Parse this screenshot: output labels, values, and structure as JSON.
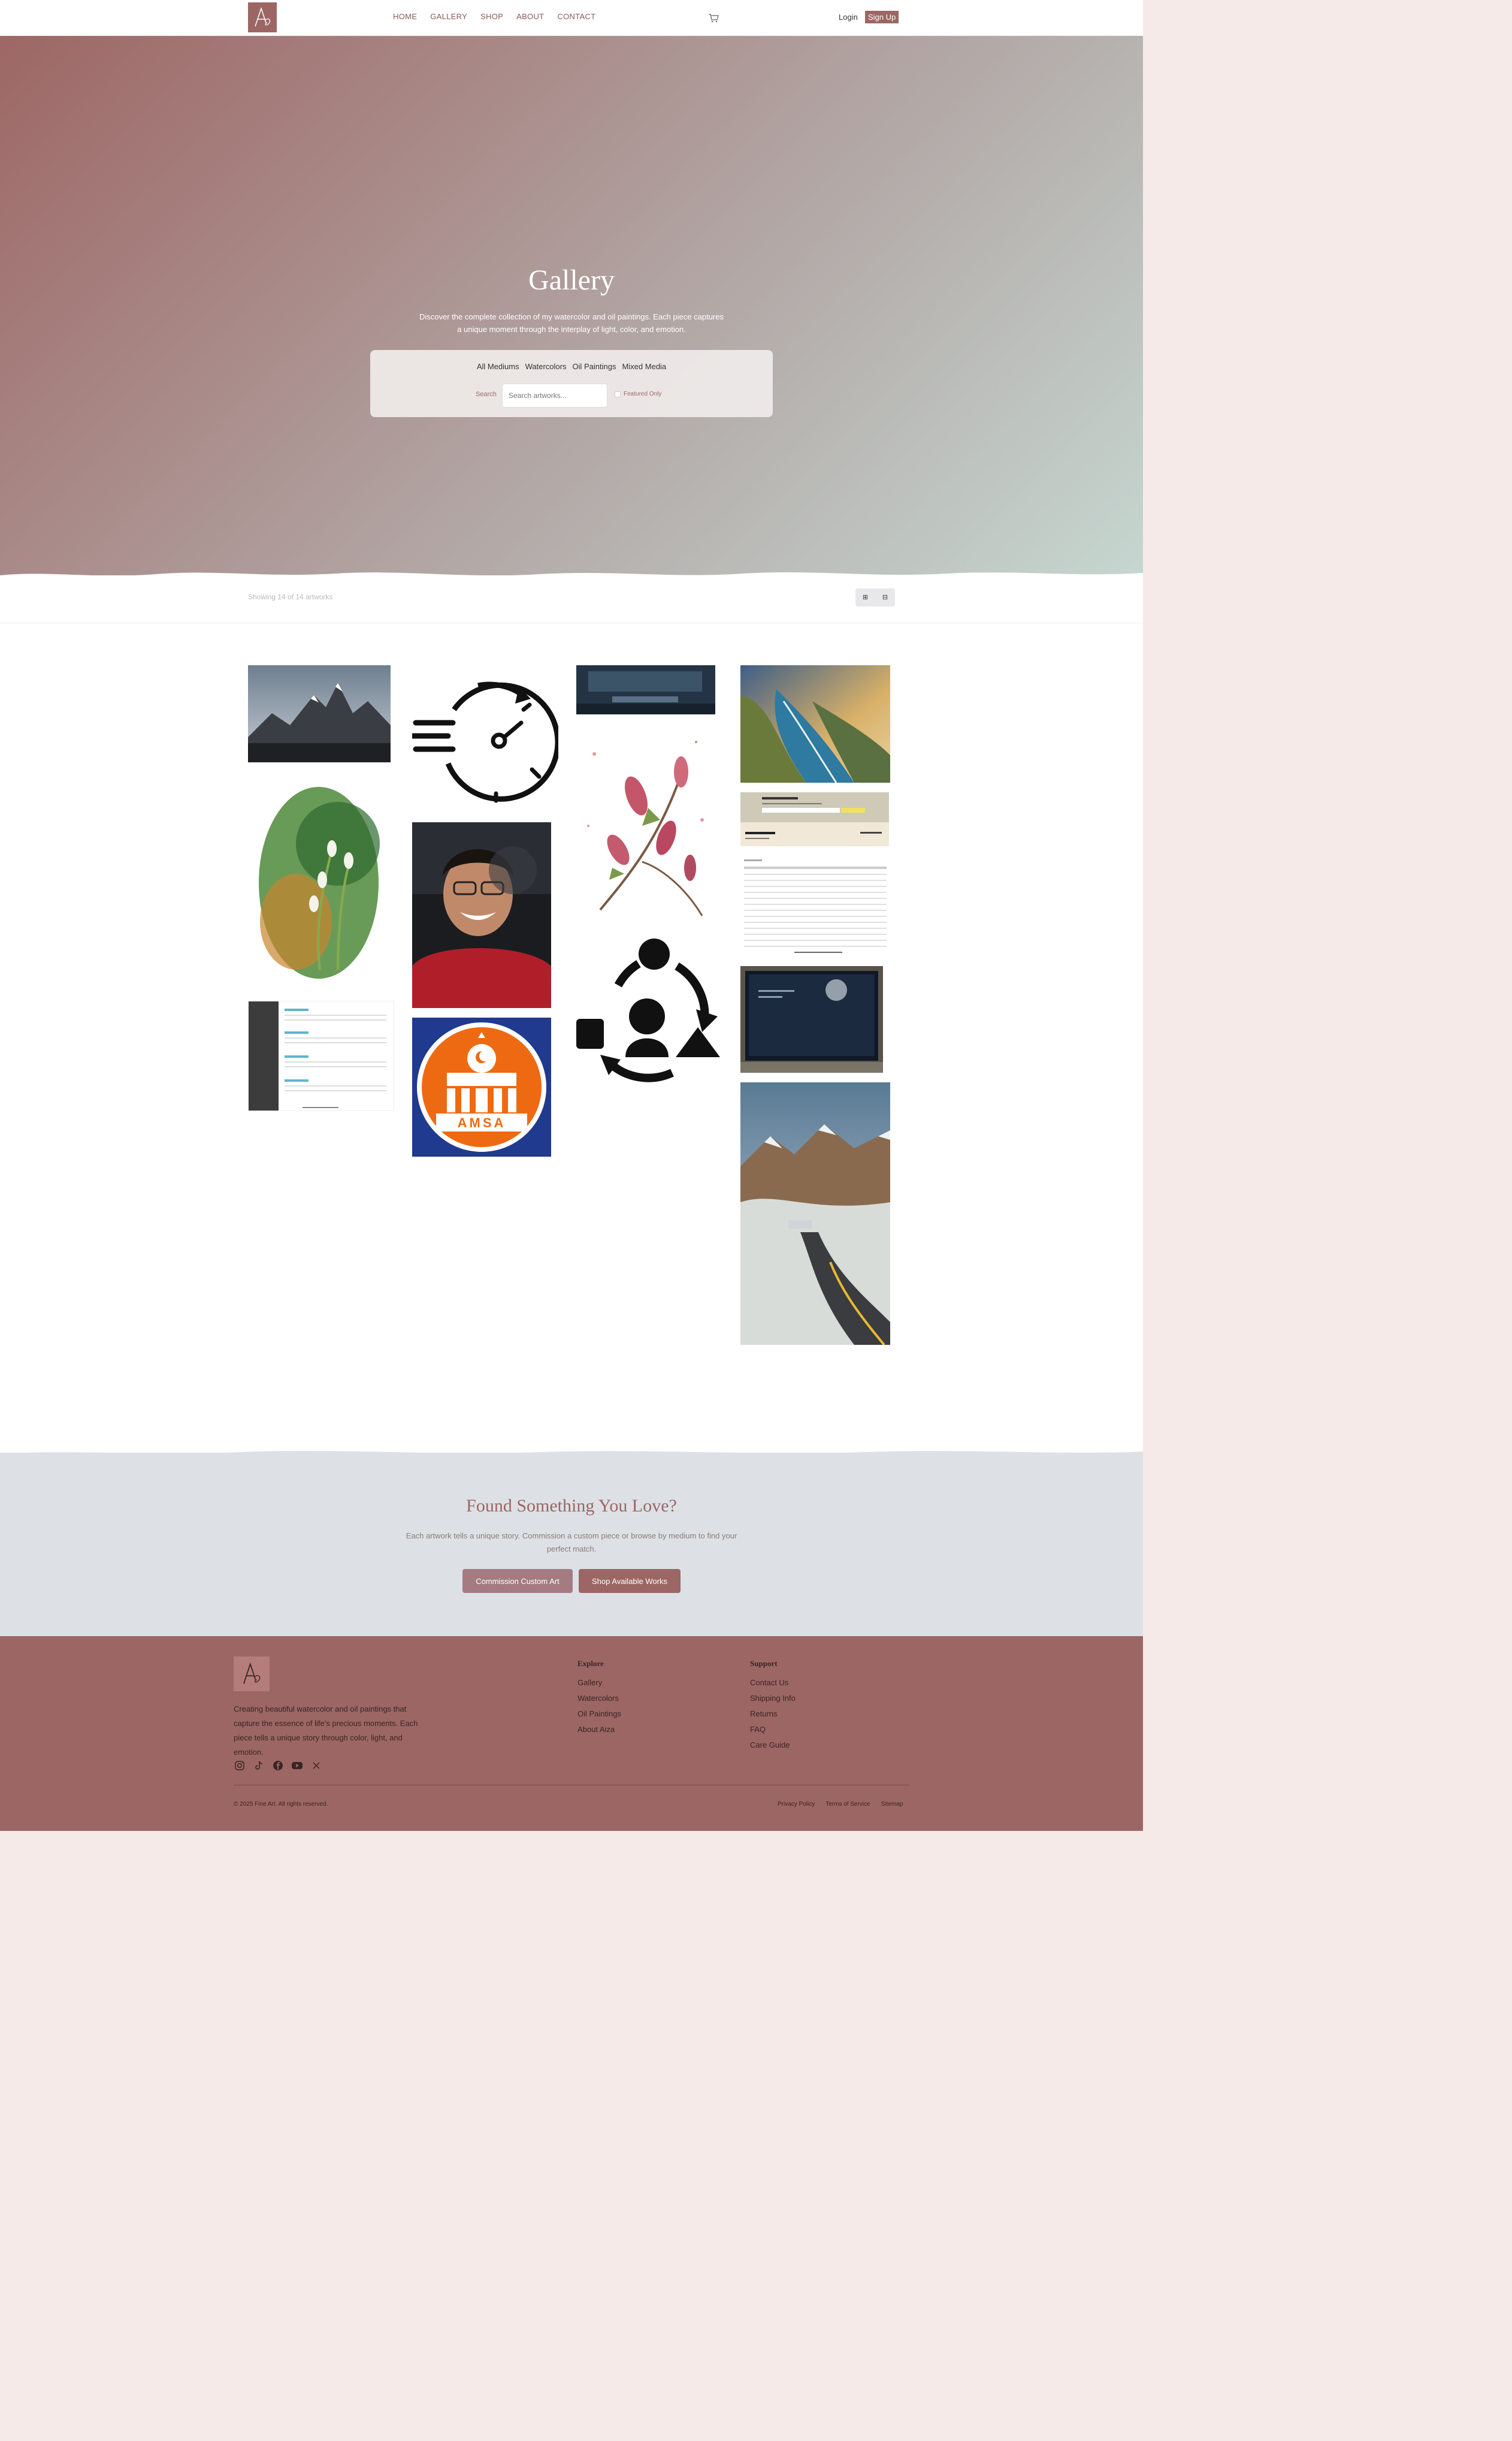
{
  "nav": {
    "links": [
      "HOME",
      "GALLERY",
      "SHOP",
      "ABOUT",
      "CONTACT"
    ],
    "login": "Login",
    "signup": "Sign Up"
  },
  "hero": {
    "title": "Gallery",
    "subtitle": "Discover the complete collection of my watercolor and oil paintings. Each piece captures a unique moment through the interplay of light, color, and emotion.",
    "filters": [
      "All Mediums",
      "Watercolors",
      "Oil Paintings",
      "Mixed Media"
    ],
    "search_label": "Search",
    "search_placeholder": "Search artworks...",
    "featured_label": "Featured Only"
  },
  "results": {
    "showing": "Showing 14 of 14 artworks"
  },
  "gallery": {
    "amsa_text": "AMSA"
  },
  "cta": {
    "title": "Found Something You Love?",
    "subtitle": "Each artwork tells a unique story. Commission a custom piece or browse by medium to find your perfect match.",
    "btn_commission": "Commission Custom Art",
    "btn_shop": "Shop Available Works"
  },
  "footer": {
    "description": "Creating beautiful watercolor and oil paintings that capture the essence of life's precious moments. Each piece tells a unique story through color, light, and emotion.",
    "explore_title": "Explore",
    "explore_links": [
      "Gallery",
      "Watercolors",
      "Oil Paintings",
      "About Aiza"
    ],
    "support_title": "Support",
    "support_links": [
      "Contact Us",
      "Shipping Info",
      "Returns",
      "FAQ",
      "Care Guide"
    ],
    "copyright": "© 2025 Fine Art. All rights reserved.",
    "bottom_links": [
      "Privacy Policy",
      "Terms of Service",
      "Sitemap"
    ]
  },
  "colors": {
    "brand": "#9c6664",
    "cta_bg": "#dde1e6"
  }
}
